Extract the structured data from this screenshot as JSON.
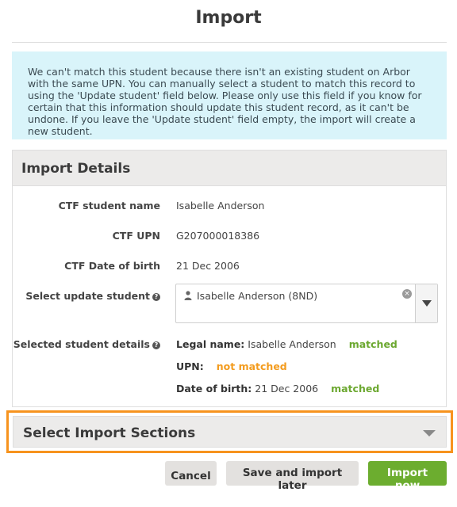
{
  "dialog": {
    "title": "Import"
  },
  "info_message": "We can't match this student because there isn't an existing student on Arbor with the same UPN. You can manually select a student to match this record to using the 'Update student' field below. Please only use this field if you know for certain that this information should update this student record, as it can't be undone. If you leave the 'Update student' field empty, the import will create a new student.",
  "import_details": {
    "heading": "Import Details",
    "ctf_name_label": "CTF student name",
    "ctf_name_value": "Isabelle Anderson",
    "ctf_upn_label": "CTF UPN",
    "ctf_upn_value": "G207000018386",
    "ctf_dob_label": "CTF Date of birth",
    "ctf_dob_value": "21 Dec 2006",
    "update_label": "Select update student",
    "update_value": "Isabelle Anderson (8ND)",
    "selected_label": "Selected student details",
    "legal_name_label": "Legal name:",
    "legal_name_value": "Isabelle Anderson",
    "legal_name_status": "matched",
    "upn_label": "UPN:",
    "upn_status": "not matched",
    "dob_label": "Date of birth:",
    "dob_value": "21 Dec 2006",
    "dob_status": "matched"
  },
  "sections": {
    "heading": "Select Import Sections"
  },
  "buttons": {
    "cancel": "Cancel",
    "save_later": "Save and import later",
    "import_now": "Import now"
  },
  "help_glyph": "?",
  "clear_glyph": "×",
  "colors": {
    "info_bg": "#d9f4fa",
    "matched": "#6ca830",
    "not_matched": "#f39c1f",
    "highlight_border": "#f7931e",
    "primary_button": "#6cad2f"
  }
}
